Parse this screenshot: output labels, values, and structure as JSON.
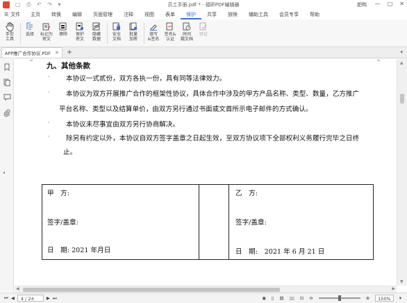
{
  "window": {
    "title": "员工手册.pdf * - 福昕PDF编辑器",
    "user": "肥鸭",
    "controls": [
      "—",
      "□",
      "✕"
    ]
  },
  "menu": {
    "file": "文件",
    "items": [
      "主页",
      "转换",
      "编辑",
      "页面管理",
      "注释",
      "视图",
      "表单",
      "保护",
      "共享",
      "放映",
      "辅助工具",
      "会员专享",
      "帮助"
    ],
    "active": "保护"
  },
  "toolbar": {
    "tools": [
      {
        "label": "手型\n工具",
        "icon": "hand-icon"
      },
      {
        "label": "选择",
        "icon": "select-icon"
      },
      {
        "label": "标记为\n密文",
        "icon": "mark-redact-icon"
      },
      {
        "label": "擦除",
        "icon": "erase-icon"
      },
      {
        "label": "保护\n密文",
        "icon": "protect-redact-icon"
      },
      {
        "label": "隐藏\n数据",
        "icon": "hide-data-icon"
      },
      {
        "label": "安全\n文档",
        "icon": "secure-doc-icon"
      },
      {
        "label": "批量\n加密",
        "icon": "batch-encrypt-icon"
      },
      {
        "label": "填写\n&签名",
        "icon": "fill-sign-icon"
      },
      {
        "label": "签名&\n认证",
        "icon": "sign-certify-icon"
      },
      {
        "label": "时间\n戳文档",
        "icon": "timestamp-icon"
      },
      {
        "label": "验证",
        "icon": "verify-icon"
      }
    ]
  },
  "tabs": [
    {
      "label": "APP推广合作协议.PDF",
      "close": "✕"
    }
  ],
  "tab_add": "+",
  "document": {
    "heading": "九、其他条款",
    "bullet": "·",
    "lines": [
      "本协议一式贰份，双方各执一份，具有同等法律效力。",
      "本协议为双方开展推广合作的框架性协议，具体合作中涉及的甲方产品名称、类型、数量，乙方推广",
      "平台名称、类型以及结算单价，由双方另行通过书面或文首所示电子邮件的方式确认。",
      "本协议未尽事宜由双方另行协商解决。",
      "除另有约定以外，本协议自双方签字盖章之日起生效，至双方协议项下全部权利义务履行完毕之日终",
      "止。"
    ],
    "table": {
      "left": {
        "party": "甲　方:",
        "sign": "签字/盖章:",
        "date": "日　期:  2021 年月日"
      },
      "right": {
        "party": "乙　方:",
        "sign": "签字/盖章:",
        "date": "日　期:　2021 年  6 月 21 日"
      }
    }
  },
  "status": {
    "page": "4 / 24",
    "zoom": "150%",
    "zoom_level": 0.5
  },
  "colors": {
    "accent": "#3b6fd8",
    "logo": "#e8412b"
  }
}
